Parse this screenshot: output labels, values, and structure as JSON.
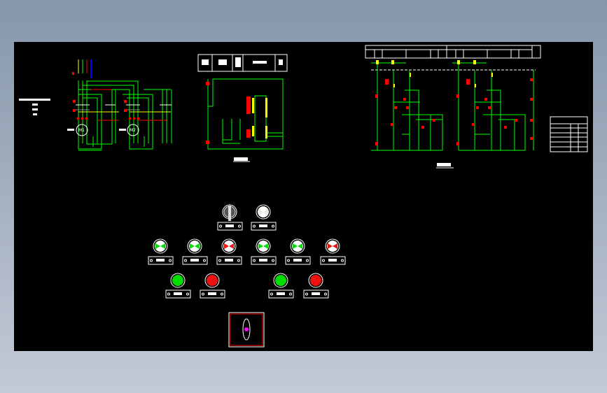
{
  "colors": {
    "background": "#000000",
    "wire": "#00ff00",
    "terminal": "#ffff00",
    "tag": "#ff0000",
    "outline": "#ffffff",
    "phase_n": "#0000ff"
  },
  "main_circuit": {
    "motors": [
      "M1",
      "M2"
    ]
  },
  "panel": {
    "row1": [
      {
        "type": "selector-switch",
        "color": "#555555"
      },
      {
        "type": "indicator-lamp",
        "color": "#e8e8e0"
      }
    ],
    "row2": [
      {
        "type": "indicator-lamp",
        "color": "#00dd00"
      },
      {
        "type": "indicator-lamp",
        "color": "#00dd00"
      },
      {
        "type": "indicator-lamp",
        "color": "#ee1111"
      },
      {
        "type": "indicator-lamp",
        "color": "#00dd00"
      },
      {
        "type": "indicator-lamp",
        "color": "#00dd00"
      },
      {
        "type": "indicator-lamp",
        "color": "#ee1111"
      }
    ],
    "row3": [
      {
        "type": "push-button",
        "color": "#00dd00"
      },
      {
        "type": "push-button",
        "color": "#ee1111"
      },
      {
        "type": "push-button",
        "color": "#00dd00"
      },
      {
        "type": "push-button",
        "color": "#ee1111"
      }
    ],
    "emergency_box": {
      "knob_color": "#ff00ff"
    }
  }
}
